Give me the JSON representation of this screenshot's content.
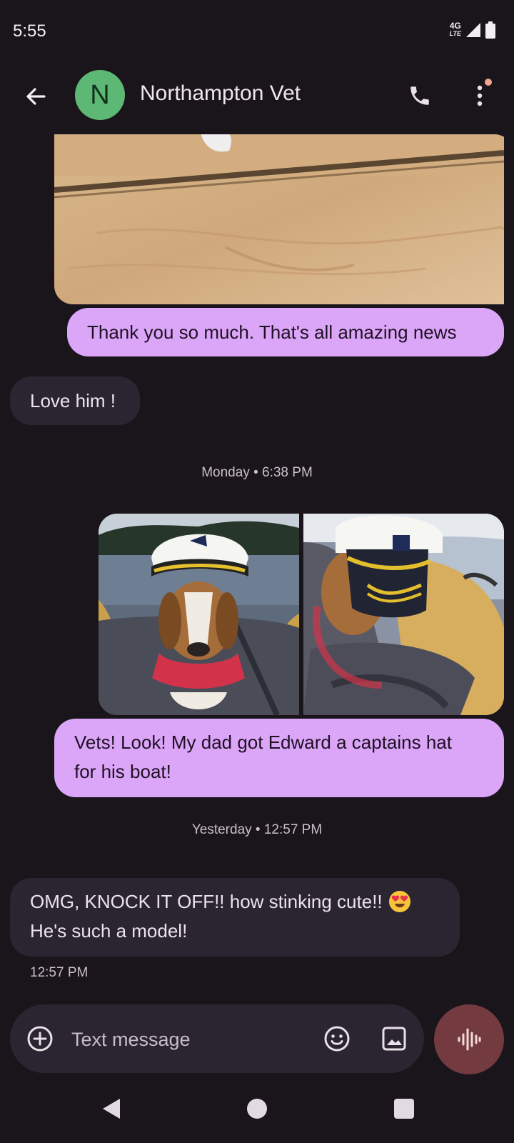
{
  "status_bar": {
    "time": "5:55",
    "network_top": "4G",
    "network_bottom": "LTE"
  },
  "header": {
    "avatar_letter": "N",
    "contact_name": "Northampton Vet"
  },
  "messages": [
    {
      "direction": "outgoing",
      "type": "text",
      "text": "Thank you so much. That's all amazing news"
    },
    {
      "direction": "incoming",
      "type": "text",
      "text": "Love him !"
    },
    {
      "type": "timestamp",
      "text": "Monday • 6:38 PM"
    },
    {
      "direction": "outgoing",
      "type": "text",
      "line1": "Vets! Look! My dad got Edward a captains hat",
      "line2": "for his boat!"
    },
    {
      "type": "timestamp",
      "text": "Yesterday • 12:57 PM"
    },
    {
      "direction": "incoming",
      "type": "text",
      "line1": "OMG, KNOCK IT OFF!! how stinking cute!!",
      "line2": "He's such a model!",
      "time": "12:57 PM"
    }
  ],
  "compose": {
    "placeholder": "Text message"
  },
  "icons": {
    "back": "arrow-left-icon",
    "call": "phone-icon",
    "more": "more-vertical-icon",
    "add": "plus-circle-icon",
    "emoji": "emoji-icon",
    "gallery": "image-icon",
    "voice": "voice-icon"
  },
  "colors": {
    "outgoing_bubble": "#dba6f7",
    "incoming_bubble": "#2a2530",
    "avatar": "#5cb874",
    "voice_button": "#733b3f",
    "background": "#1a151b"
  }
}
